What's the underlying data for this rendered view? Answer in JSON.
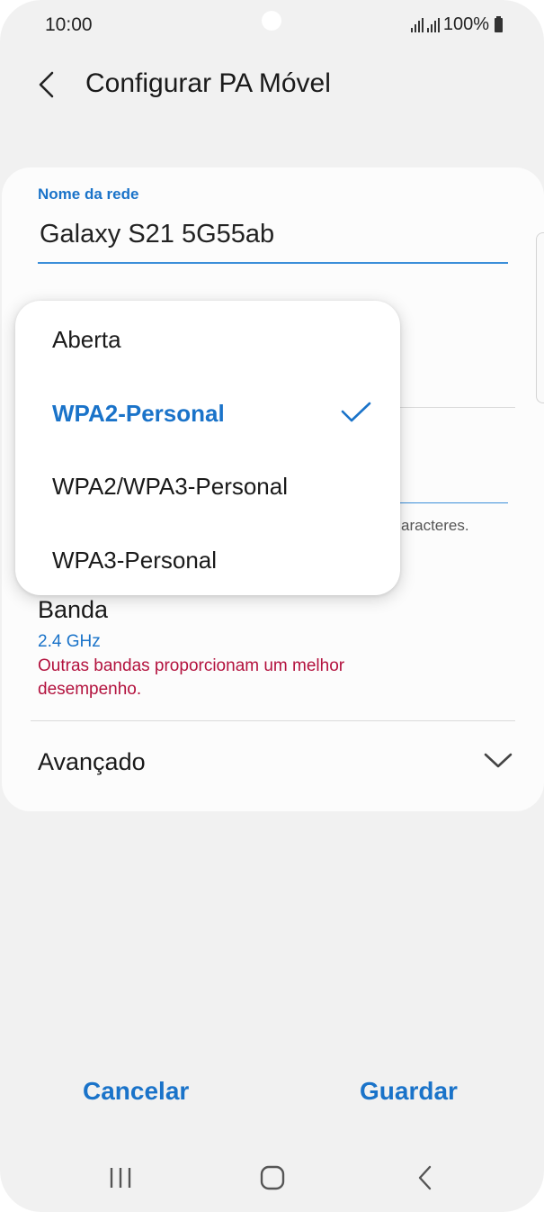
{
  "status_bar": {
    "time": "10:00",
    "battery": "100%"
  },
  "header": {
    "title": "Configurar PA Móvel"
  },
  "network": {
    "label": "Nome da rede",
    "value": "Galaxy S21 5G55ab"
  },
  "password_hint_fragment": "aracteres.",
  "security_menu": {
    "items": [
      "Aberta",
      "WPA2-Personal",
      "WPA2/WPA3-Personal",
      "WPA3-Personal"
    ],
    "selected": "WPA2-Personal"
  },
  "band": {
    "title": "Banda",
    "value": "2.4 GHz",
    "warning": "Outras bandas proporcionam um melhor desempenho."
  },
  "advanced": {
    "label": "Avançado"
  },
  "buttons": {
    "cancel": "Cancelar",
    "save": "Guardar"
  },
  "colors": {
    "accent": "#1a73c9",
    "warning": "#b3123e",
    "background": "#f1f1f1"
  }
}
